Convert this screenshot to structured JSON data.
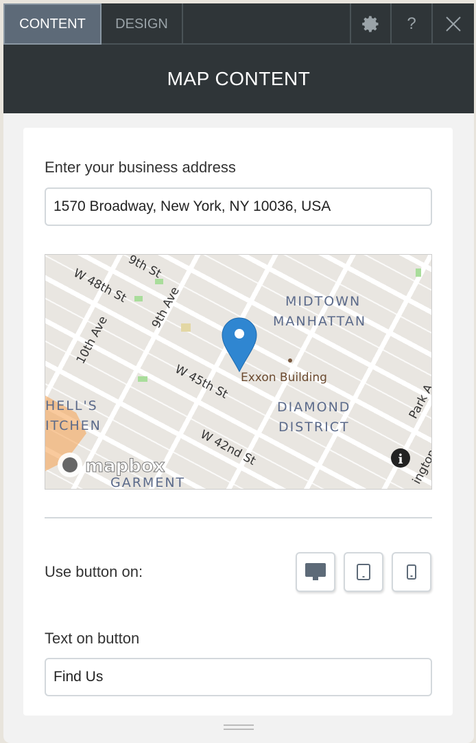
{
  "tabs": [
    {
      "label": "CONTENT",
      "active": true
    },
    {
      "label": "DESIGN",
      "active": false
    }
  ],
  "toolbar_icons": [
    "gear-icon",
    "help-icon",
    "close-icon"
  ],
  "help_label": "?",
  "header": {
    "title": "MAP CONTENT"
  },
  "address": {
    "label": "Enter your business address",
    "value": "1570 Broadway, New York, NY 10036, USA"
  },
  "map": {
    "labels": {
      "w48": "W 48th St",
      "w49": "9th St",
      "tenth": "10th Ave",
      "ninth": "9th Ave",
      "midtown1": "MIDTOWN",
      "midtown2": "MANHATTAN",
      "exxon": "Exxon Building",
      "w45": "W 45th St",
      "hells1": "HELL'S",
      "hells2": "ITCHEN",
      "diamond1": "DIAMOND",
      "diamond2": "DISTRICT",
      "w42": "W 42nd St",
      "garment": "GARMENT",
      "park": "Park A",
      "lex": "ington",
      "mapbox": "mapbox"
    },
    "pin_color": "#2f86d1"
  },
  "use_button": {
    "label": "Use button on:",
    "devices": [
      "desktop-icon",
      "tablet-icon",
      "mobile-icon"
    ]
  },
  "button_text": {
    "label": "Text on button",
    "value": "Find Us"
  }
}
